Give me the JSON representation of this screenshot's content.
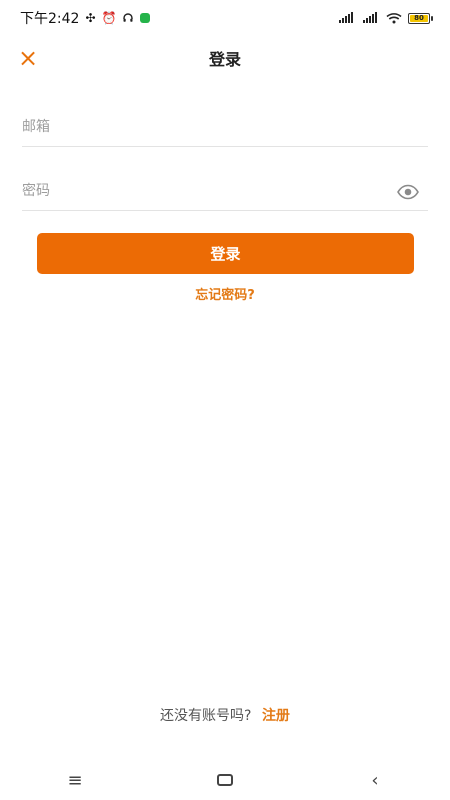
{
  "status_bar": {
    "time": "下午2:42",
    "battery_level": "80",
    "icons": [
      "sync-off-icon",
      "alarm-icon",
      "headphones-icon",
      "app-badge-icon",
      "signal-icon",
      "signal-icon-2",
      "wifi-icon",
      "battery-icon"
    ]
  },
  "header": {
    "title": "登录",
    "close_icon": "close-icon"
  },
  "form": {
    "email_placeholder": "邮箱",
    "password_placeholder": "密码",
    "show_password_icon": "eye-icon",
    "submit_label": "登录",
    "forgot_password_label": "忘记密码?"
  },
  "footer": {
    "prompt": "还没有账号吗?",
    "register_label": "注册"
  },
  "colors": {
    "accent": "#ec6b05",
    "link": "#e37a16",
    "battery": "#f3c400",
    "status_badge": "#25b34a"
  },
  "nav": {
    "icons": [
      "menu-icon",
      "home-icon",
      "back-icon"
    ]
  }
}
